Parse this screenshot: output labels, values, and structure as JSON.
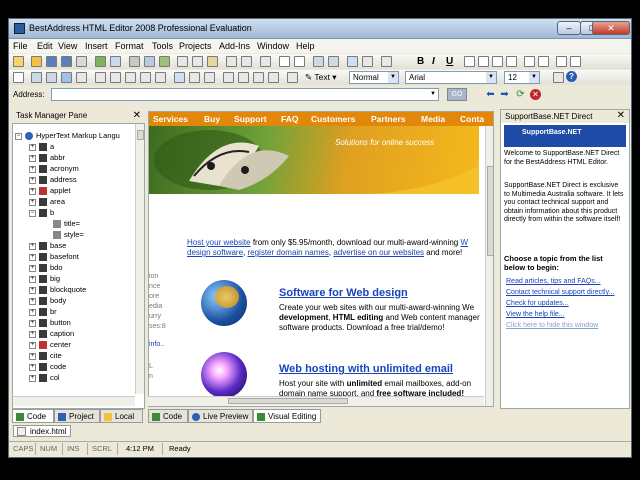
{
  "window": {
    "title": "BestAddress HTML Editor 2008 Professional Evaluation"
  },
  "menu": [
    "File",
    "Edit",
    "View",
    "Insert",
    "Format",
    "Tools",
    "Projects",
    "Add-Ins",
    "Window",
    "Help"
  ],
  "format_toolbar": {
    "text_button": "Text",
    "style_combo": "Normal",
    "font_combo": "Arial",
    "size_combo": "12",
    "bold": "B",
    "italic": "I",
    "underline": "U"
  },
  "address_bar": {
    "label": "Address:",
    "value": "",
    "go_label": "GO"
  },
  "task_pane": {
    "title": "Task Manager Pane",
    "root": "HyperText Markup Langu",
    "items": [
      "a",
      "abbr",
      "acronym",
      "address",
      "applet",
      "area",
      "b",
      "title=",
      "style=",
      "base",
      "basefont",
      "bdo",
      "big",
      "blockquote",
      "body",
      "br",
      "button",
      "caption",
      "center",
      "cite",
      "code",
      "col"
    ],
    "tabs": [
      "Code",
      "Project",
      "Local"
    ]
  },
  "editor": {
    "nav": [
      "Services",
      "Buy",
      "Support",
      "FAQ",
      "Customers",
      "Partners",
      "Media",
      "Conta"
    ],
    "hero_tagline": "Solutions for online success",
    "intro": {
      "link1": "Host your website",
      "text1": " from only $5.95/month, download our multi-award-winning ",
      "link2": "W",
      "link3": "design software",
      "link4": "register domain names",
      "link5": "advertise on our websites",
      "text2": " and more!"
    },
    "left_fragments": [
      "ion",
      "nce",
      "ore",
      "edia",
      "urry",
      "ses:8",
      "info..",
      "L",
      "n"
    ],
    "section1": {
      "heading": "Software for Web design",
      "line1": "Create your web sites with our multi-award-winning We",
      "line2a": "development",
      "line2b": ", ",
      "line2c": "HTML editing",
      "line2d": " and Web content manager",
      "line3": "software products. Download a free trial/demo!"
    },
    "section2": {
      "heading": "Web hosting with unlimited email",
      "line1a": "Host your site with ",
      "line1b": "unlimited",
      "line1c": " email mailboxes, add-on",
      "line2a": "domain name support, and ",
      "line2b": "free software included!"
    },
    "tabs": [
      "Code",
      "Live Preview",
      "Visual Editing"
    ]
  },
  "support_pane": {
    "title": "SupportBase.NET Direct",
    "banner": "SupportBase.NET",
    "welcome": "Welcome to SupportBase.NET Direct for the BestAddress HTML Editor.",
    "body": "SupportBase.NET Direct is exclusive to Multimedia Australia software. It lets you contact technical support and obtain information about this product directly from within the software itself!",
    "prompt": "Choose a topic from the list below to begin:",
    "links": [
      "Read articles, tips and FAQs...",
      "Contact technical support directly...",
      "Check for updates...",
      "View the help file..."
    ],
    "hide_link": "Click here to hide this window"
  },
  "document_tab": "index.html",
  "status": {
    "caps": "CAPS",
    "num": "NUM",
    "ins": "INS",
    "scrl": "SCRL",
    "time": "4:12 PM",
    "state": "Ready"
  }
}
